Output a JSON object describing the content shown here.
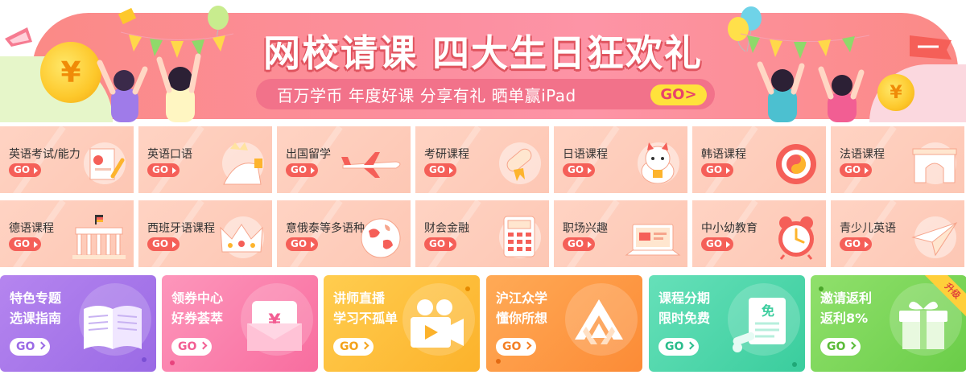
{
  "banner": {
    "title": "网校请课 四大生日狂欢礼",
    "subtitle": "百万学币  年度好课  分享有礼  晒单赢iPad",
    "go_label": "GO>",
    "coin_symbol": "¥"
  },
  "go_label": "GO",
  "categories": [
    {
      "label": "英语考试/能力",
      "icon": "certificate-icon"
    },
    {
      "label": "英语口语",
      "icon": "statue-of-liberty-icon"
    },
    {
      "label": "出国留学",
      "icon": "airplane-icon"
    },
    {
      "label": "考研课程",
      "icon": "diploma-scroll-icon"
    },
    {
      "label": "日语课程",
      "icon": "lucky-cat-icon"
    },
    {
      "label": "韩语课程",
      "icon": "taegeuk-icon"
    },
    {
      "label": "法语课程",
      "icon": "arc-de-triomphe-icon"
    },
    {
      "label": "德语课程",
      "icon": "brandenburg-gate-icon"
    },
    {
      "label": "西班牙语课程",
      "icon": "crown-icon"
    },
    {
      "label": "意俄泰等多语种",
      "icon": "globe-icon"
    },
    {
      "label": "财会金融",
      "icon": "calculator-icon"
    },
    {
      "label": "职场兴趣",
      "icon": "laptop-icon"
    },
    {
      "label": "中小幼教育",
      "icon": "alarm-clock-icon"
    },
    {
      "label": "青少儿英语",
      "icon": "paper-plane-icon"
    }
  ],
  "cards": [
    {
      "line1": "特色专题",
      "line2": "选课指南",
      "go": "GO",
      "icon": "open-book-icon",
      "color_from": "#b383ee",
      "color_to": "#9b6be6",
      "go_color": "#9b6be6"
    },
    {
      "line1": "领券中心",
      "line2": "好券荟萃",
      "go": "GO",
      "icon": "coupon-icon",
      "color_from": "#fc92b8",
      "color_to": "#f96fa0",
      "go_color": "#f25e93"
    },
    {
      "line1": "讲师直播",
      "line2": "学习不孤单",
      "go": "GO",
      "icon": "video-camera-icon",
      "color_from": "#ffcb4a",
      "color_to": "#fdb42d",
      "go_color": "#f3a21a"
    },
    {
      "line1": "沪江众学",
      "line2": "懂你所想",
      "go": "GO",
      "icon": "mountain-logo-icon",
      "color_from": "#ffa853",
      "color_to": "#fd8d38",
      "go_color": "#f47f24"
    },
    {
      "line1": "课程分期",
      "line2": "限时免费",
      "go": "GO",
      "icon": "free-document-icon",
      "color_from": "#62dfb7",
      "color_to": "#3ccf9f",
      "go_color": "#2bbd8c"
    },
    {
      "line1": "邀请返利",
      "line2": "返利8%",
      "go": "GO",
      "icon": "gift-box-icon",
      "color_from": "#8ddf6a",
      "color_to": "#6cce4a",
      "go_color": "#5abb38",
      "ribbon": "升级"
    }
  ]
}
